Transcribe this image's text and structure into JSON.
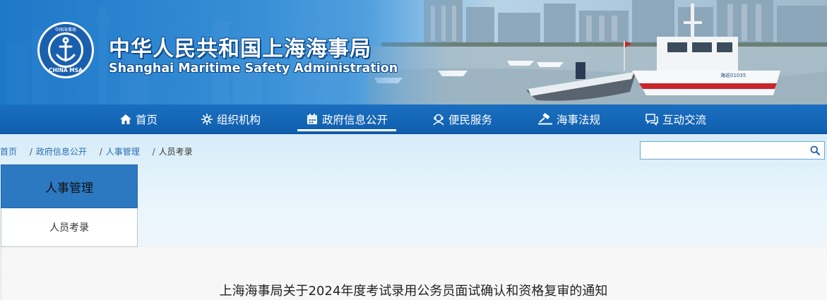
{
  "header": {
    "site_title_cn": "中华人民共和国上海海事局",
    "site_title_en": "Shanghai Maritime Safety Administration",
    "logo_text": "CHINA MSA",
    "logo_text_cn": "中国海事局",
    "boat_hull_text": "海巡01035"
  },
  "nav": {
    "items": [
      {
        "label": "首页",
        "icon": "home-icon"
      },
      {
        "label": "组织机构",
        "icon": "org-icon"
      },
      {
        "label": "政府信息公开",
        "icon": "calendar-icon",
        "active": true
      },
      {
        "label": "便民服务",
        "icon": "service-icon"
      },
      {
        "label": "海事法规",
        "icon": "gavel-icon"
      },
      {
        "label": "互动交流",
        "icon": "chat-icon"
      }
    ]
  },
  "breadcrumb": {
    "items": [
      "首页",
      "政府信息公开",
      "人事管理",
      "人员考录"
    ],
    "separator": "/"
  },
  "search": {
    "placeholder": "",
    "value": "",
    "icon": "search-icon"
  },
  "sidebar": {
    "heading": "人事管理",
    "items": [
      {
        "label": "人员考录"
      }
    ]
  },
  "article": {
    "title": "上海海事局关于2024年度考试录用公务员面试确认和资格复审的通知"
  },
  "colors": {
    "nav_bg": "#1567b8",
    "sidebar_heading_bg": "#2c79c2",
    "link": "#2a6db3",
    "banner_start": "#1e78c8"
  }
}
